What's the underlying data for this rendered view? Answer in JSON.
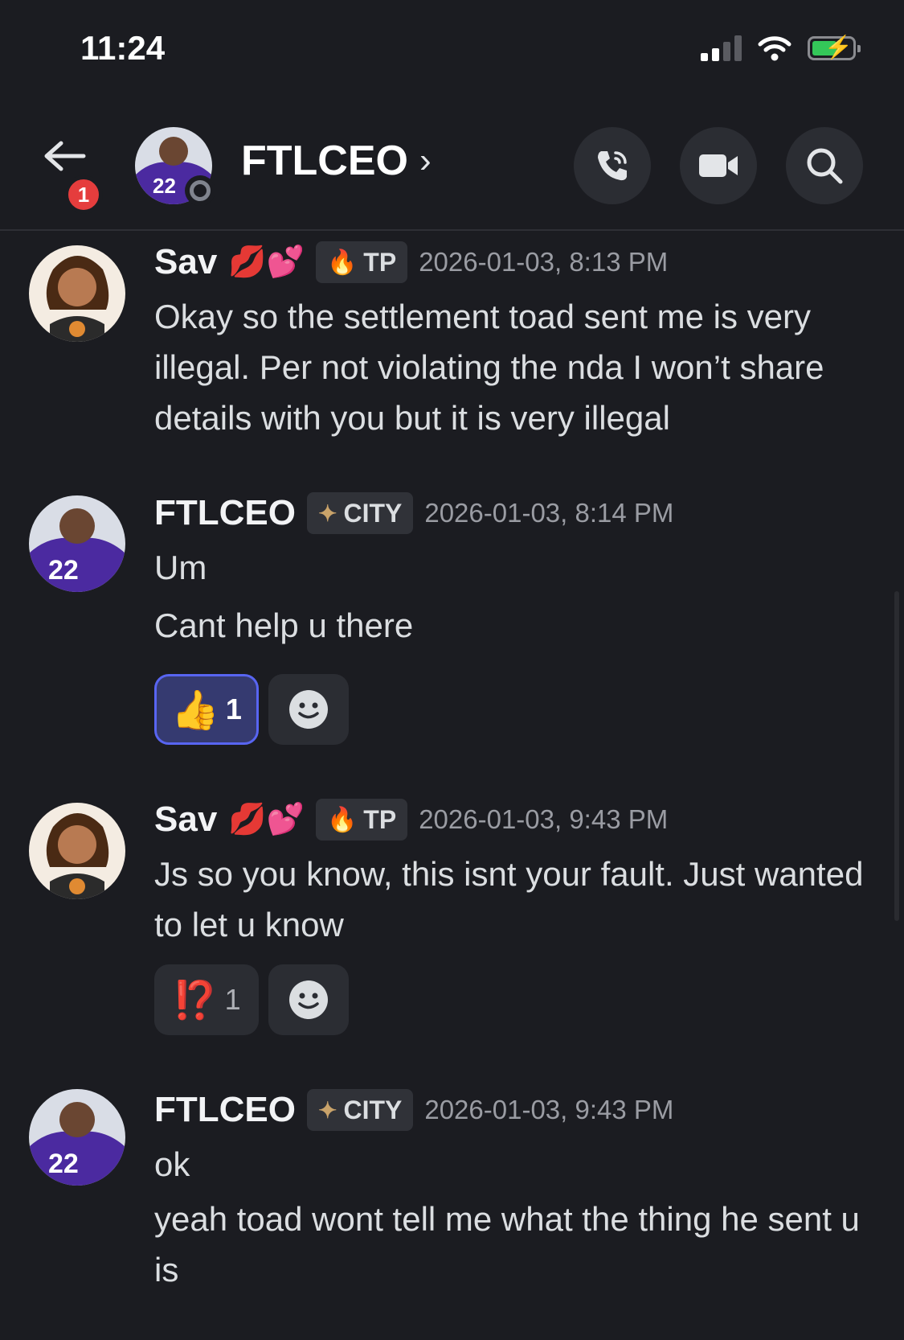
{
  "status_bar": {
    "time": "11:24"
  },
  "header": {
    "title": "FTLCEO",
    "unread_count": "1",
    "chevron": "›"
  },
  "messages": [
    {
      "author": "Sav",
      "deco": "💋💕",
      "tag": "TP",
      "tag_icon": "flame-icon",
      "timestamp": "2026-01-03, 8:13 PM",
      "lines": [
        "Okay so the settlement toad sent me is very illegal. Per not violating the nda I won’t share details with you but it is very illegal"
      ]
    },
    {
      "author": "FTLCEO",
      "tag": "CITY",
      "tag_icon": "sparkle-icon",
      "timestamp": "2026-01-03, 8:14 PM",
      "lines": [
        "Um",
        "Cant help u there"
      ],
      "reactions": [
        {
          "emoji": "👍",
          "count": "1"
        }
      ]
    },
    {
      "author": "Sav",
      "deco": "💋💕",
      "tag": "TP",
      "tag_icon": "flame-icon",
      "timestamp": "2026-01-03, 9:43 PM",
      "lines": [
        "Js so you know, this isnt your fault. Just wanted to let u know"
      ],
      "reactions": [
        {
          "emoji": "⁉️",
          "count": "1"
        }
      ]
    },
    {
      "author": "FTLCEO",
      "tag": "CITY",
      "tag_icon": "sparkle-icon",
      "timestamp": "2026-01-03, 9:43 PM",
      "lines": [
        "ok",
        "yeah toad wont tell me what the thing he sent u is"
      ]
    }
  ],
  "colors": {
    "accent": "#5865f2",
    "badge": "#e53d3d",
    "battery": "#34c759"
  }
}
